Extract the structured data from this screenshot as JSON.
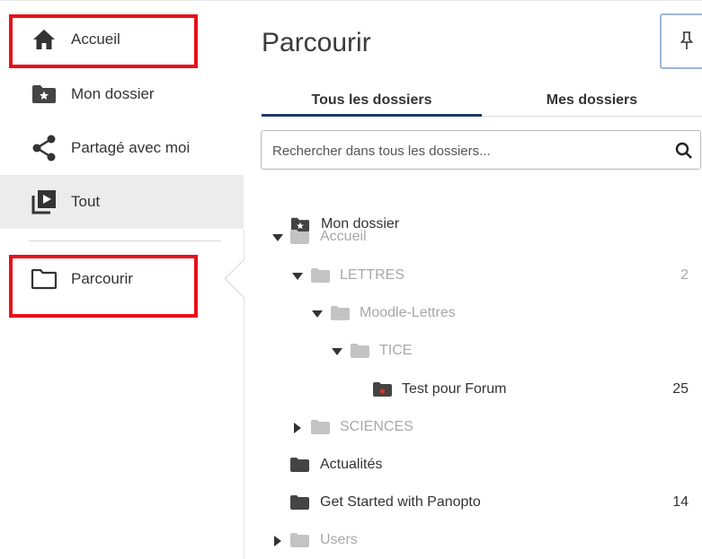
{
  "sidebar": {
    "items": [
      {
        "label": "Accueil",
        "icon": "home-icon"
      },
      {
        "label": "Mon dossier",
        "icon": "starred-folder-icon"
      },
      {
        "label": "Partagé avec moi",
        "icon": "share-icon"
      },
      {
        "label": "Tout",
        "icon": "video-library-icon",
        "selected": true
      },
      {
        "label": "Parcourir",
        "icon": "folder-outline-icon"
      }
    ]
  },
  "main": {
    "title": "Parcourir",
    "tabs": [
      {
        "label": "Tous les dossiers",
        "active": true
      },
      {
        "label": "Mes dossiers",
        "active": false
      }
    ],
    "search": {
      "placeholder": "Rechercher dans tous les dossiers..."
    },
    "tree": [
      {
        "label": "Mon dossier",
        "count": "",
        "muted": false
      },
      {
        "label": "Accueil",
        "count": "",
        "muted": true,
        "expanded": true
      },
      {
        "label": "LETTRES",
        "count": "2",
        "muted": true,
        "expanded": true
      },
      {
        "label": "Moodle-Lettres",
        "count": "",
        "muted": true,
        "expanded": true
      },
      {
        "label": "TICE",
        "count": "",
        "muted": true,
        "expanded": true
      },
      {
        "label": "Test pour Forum",
        "count": "25",
        "muted": false
      },
      {
        "label": "SCIENCES",
        "count": "",
        "muted": true,
        "expanded": false
      },
      {
        "label": "Actualités",
        "count": "",
        "muted": false
      },
      {
        "label": "Get Started with Panopto",
        "count": "14",
        "muted": false
      },
      {
        "label": "Users",
        "count": "",
        "muted": true,
        "expanded": false
      }
    ]
  },
  "colors": {
    "highlight": "#e8101a",
    "accent": "#1f3864",
    "selected_bg": "#ececec",
    "muted_text": "#a8a8a8",
    "folder_dark": "#444444",
    "folder_muted": "#c3c3c3"
  }
}
